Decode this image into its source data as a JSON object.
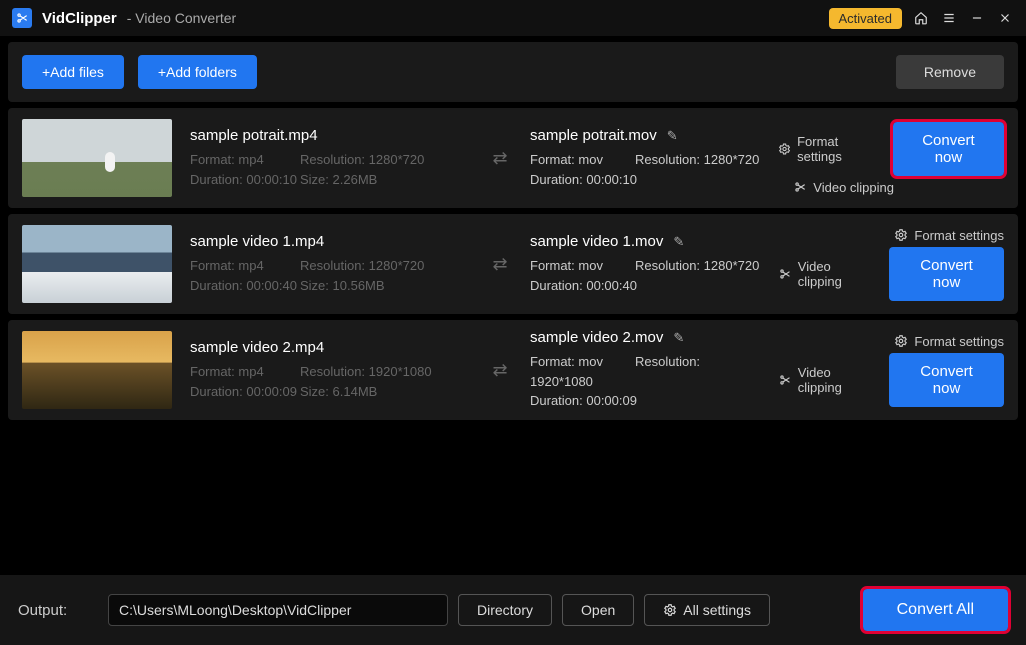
{
  "titlebar": {
    "app_name": "VidClipper",
    "subtitle": "- Video Converter",
    "activated": "Activated"
  },
  "toolbar": {
    "add_files": "+Add files",
    "add_folders": "+Add folders",
    "remove": "Remove"
  },
  "labels": {
    "format": "Format:",
    "resolution": "Resolution:",
    "duration": "Duration:",
    "size": "Size:",
    "format_settings": "Format settings",
    "video_clipping": "Video clipping",
    "convert_now": "Convert now"
  },
  "items": [
    {
      "src_name": "sample potrait.mp4",
      "src_format": "mp4",
      "src_res": "1280*720",
      "src_dur": "00:00:10",
      "src_size": "2.26MB",
      "dst_name": "sample potrait.mov",
      "dst_format": "mov",
      "dst_res": "1280*720",
      "dst_dur": "00:00:10",
      "highlighted": true
    },
    {
      "src_name": "sample video 1.mp4",
      "src_format": "mp4",
      "src_res": "1280*720",
      "src_dur": "00:00:40",
      "src_size": "10.56MB",
      "dst_name": "sample video 1.mov",
      "dst_format": "mov",
      "dst_res": "1280*720",
      "dst_dur": "00:00:40",
      "highlighted": false
    },
    {
      "src_name": "sample video 2.mp4",
      "src_format": "mp4",
      "src_res": "1920*1080",
      "src_dur": "00:00:09",
      "src_size": "6.14MB",
      "dst_name": "sample video 2.mov",
      "dst_format": "mov",
      "dst_res": "1920*1080",
      "dst_dur": "00:00:09",
      "highlighted": false
    }
  ],
  "bottom": {
    "output_label": "Output:",
    "output_path": "C:\\Users\\MLoong\\Desktop\\VidClipper",
    "directory": "Directory",
    "open": "Open",
    "all_settings": "All settings",
    "convert_all": "Convert All"
  }
}
